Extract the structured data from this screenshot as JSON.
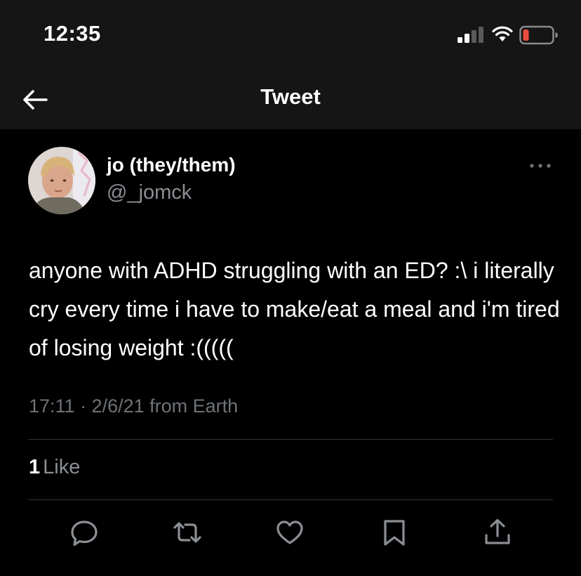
{
  "status_bar": {
    "time": "12:35",
    "signal_icon": "cellular-signal-icon",
    "wifi_icon": "wifi-icon",
    "battery_icon": "battery-low-icon",
    "battery_color": "#eb4d3d"
  },
  "header": {
    "title": "Tweet",
    "back_icon": "back-arrow-icon"
  },
  "tweet": {
    "display_name": "jo (they/them)",
    "handle": "@_jomck",
    "text": "anyone with ADHD struggling with an ED? :\\ i literally cry every time i have to make/eat a meal and i'm tired of losing weight :(((((",
    "meta": "17:11 · 2/6/21 from Earth",
    "likes_count": "1",
    "likes_label": "Like"
  },
  "actions": [
    {
      "name": "reply",
      "icon": "reply-icon"
    },
    {
      "name": "retweet",
      "icon": "retweet-icon"
    },
    {
      "name": "like",
      "icon": "heart-icon"
    },
    {
      "name": "bookmark",
      "icon": "bookmark-icon"
    },
    {
      "name": "share",
      "icon": "share-icon"
    }
  ],
  "colors": {
    "background": "#000000",
    "header_background": "#151515",
    "text_primary": "#ffffff",
    "text_secondary": "#8b8f94",
    "divider": "#2f3336",
    "icon": "#8b8f94"
  }
}
